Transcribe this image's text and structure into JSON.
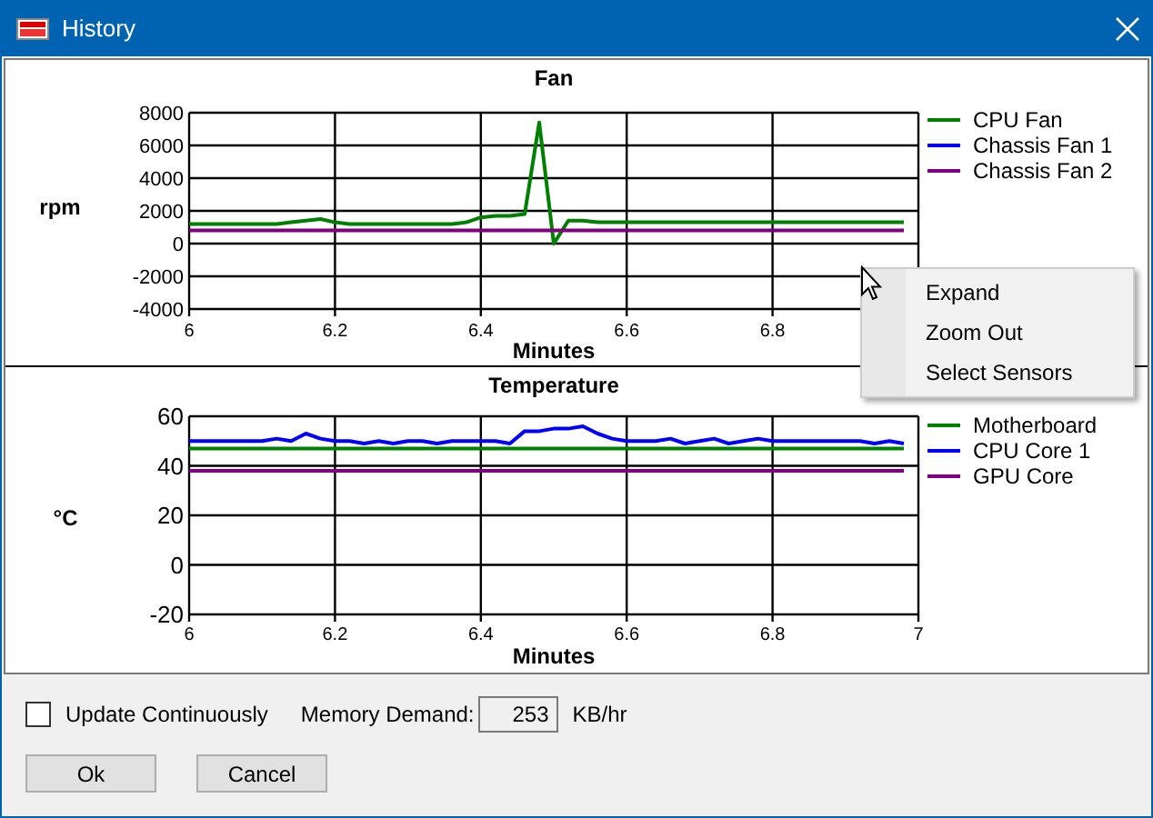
{
  "window": {
    "title": "History"
  },
  "charts": [
    {
      "kind": "fan",
      "chart_data": {
        "type": "line",
        "title": "Fan",
        "xlabel": "Minutes",
        "ylabel": "rpm",
        "grid": true,
        "legend": "right",
        "xlim": [
          6,
          7
        ],
        "ylim": [
          -4000,
          8000
        ],
        "xticks": [
          6,
          6.2,
          6.4,
          6.6,
          6.8
        ],
        "yticks": [
          -4000,
          -2000,
          0,
          2000,
          4000,
          6000,
          8000
        ],
        "x": [
          6,
          6.02,
          6.04,
          6.06,
          6.08,
          6.1,
          6.12,
          6.14,
          6.16,
          6.18,
          6.2,
          6.22,
          6.24,
          6.26,
          6.28,
          6.3,
          6.32,
          6.34,
          6.36,
          6.38,
          6.4,
          6.42,
          6.44,
          6.46,
          6.48,
          6.5,
          6.52,
          6.54,
          6.56,
          6.58,
          6.6,
          6.62,
          6.64,
          6.66,
          6.68,
          6.7,
          6.72,
          6.74,
          6.76,
          6.78,
          6.8,
          6.82,
          6.84,
          6.86,
          6.88,
          6.9,
          6.92,
          6.94,
          6.96,
          6.98
        ],
        "series": [
          {
            "name": "CPU Fan",
            "color": "#008000",
            "values": [
              1200,
              1200,
              1200,
              1200,
              1200,
              1200,
              1200,
              1300,
              1400,
              1500,
              1300,
              1200,
              1200,
              1200,
              1200,
              1200,
              1200,
              1200,
              1200,
              1300,
              1600,
              1700,
              1700,
              1800,
              7400,
              0,
              1400,
              1400,
              1300,
              1300,
              1300,
              1300,
              1300,
              1300,
              1300,
              1300,
              1300,
              1300,
              1300,
              1300,
              1300,
              1300,
              1300,
              1300,
              1300,
              1300,
              1300,
              1300,
              1300,
              1300
            ]
          },
          {
            "name": "Chassis Fan 1",
            "color": "#0000ff",
            "values": [
              null,
              null,
              null,
              null,
              null,
              null,
              null,
              null,
              null,
              null,
              null,
              null,
              null,
              null,
              null,
              null,
              null,
              null,
              null,
              null,
              null,
              null,
              null,
              null,
              null,
              null,
              null,
              null,
              null,
              null,
              null,
              null,
              null,
              null,
              null,
              null,
              null,
              null,
              null,
              null,
              null,
              null,
              null,
              null,
              null,
              null,
              null,
              null,
              null,
              null
            ]
          },
          {
            "name": "Chassis Fan 2",
            "color": "#800080",
            "values": [
              800,
              800,
              800,
              800,
              800,
              800,
              800,
              800,
              800,
              800,
              800,
              800,
              800,
              800,
              800,
              800,
              800,
              800,
              800,
              800,
              800,
              800,
              800,
              800,
              800,
              800,
              800,
              800,
              800,
              800,
              800,
              800,
              800,
              800,
              800,
              800,
              800,
              800,
              800,
              800,
              800,
              800,
              800,
              800,
              800,
              800,
              800,
              800,
              800,
              800
            ]
          }
        ]
      }
    },
    {
      "kind": "temperature",
      "chart_data": {
        "type": "line",
        "title": "Temperature",
        "xlabel": "Minutes",
        "ylabel": "°C",
        "grid": true,
        "legend": "right",
        "xlim": [
          6,
          7
        ],
        "ylim": [
          -20,
          60
        ],
        "xticks": [
          6,
          6.2,
          6.4,
          6.6,
          6.8,
          7
        ],
        "yticks": [
          -20,
          0,
          20,
          40,
          60
        ],
        "x": [
          6,
          6.02,
          6.04,
          6.06,
          6.08,
          6.1,
          6.12,
          6.14,
          6.16,
          6.18,
          6.2,
          6.22,
          6.24,
          6.26,
          6.28,
          6.3,
          6.32,
          6.34,
          6.36,
          6.38,
          6.4,
          6.42,
          6.44,
          6.46,
          6.48,
          6.5,
          6.52,
          6.54,
          6.56,
          6.58,
          6.6,
          6.62,
          6.64,
          6.66,
          6.68,
          6.7,
          6.72,
          6.74,
          6.76,
          6.78,
          6.8,
          6.82,
          6.84,
          6.86,
          6.88,
          6.9,
          6.92,
          6.94,
          6.96,
          6.98
        ],
        "series": [
          {
            "name": "Motherboard",
            "color": "#008000",
            "values": [
              47,
              47,
              47,
              47,
              47,
              47,
              47,
              47,
              47,
              47,
              47,
              47,
              47,
              47,
              47,
              47,
              47,
              47,
              47,
              47,
              47,
              47,
              47,
              47,
              47,
              47,
              47,
              47,
              47,
              47,
              47,
              47,
              47,
              47,
              47,
              47,
              47,
              47,
              47,
              47,
              47,
              47,
              47,
              47,
              47,
              47,
              47,
              47,
              47,
              47
            ]
          },
          {
            "name": "CPU Core 1",
            "color": "#0000ff",
            "values": [
              50,
              50,
              50,
              50,
              50,
              50,
              51,
              50,
              53,
              51,
              50,
              50,
              49,
              50,
              49,
              50,
              50,
              49,
              50,
              50,
              50,
              50,
              49,
              54,
              54,
              55,
              55,
              56,
              53,
              51,
              50,
              50,
              50,
              51,
              49,
              50,
              51,
              49,
              50,
              51,
              50,
              50,
              50,
              50,
              50,
              50,
              50,
              49,
              50,
              49
            ]
          },
          {
            "name": "GPU Core",
            "color": "#800080",
            "values": [
              38,
              38,
              38,
              38,
              38,
              38,
              38,
              38,
              38,
              38,
              38,
              38,
              38,
              38,
              38,
              38,
              38,
              38,
              38,
              38,
              38,
              38,
              38,
              38,
              38,
              38,
              38,
              38,
              38,
              38,
              38,
              38,
              38,
              38,
              38,
              38,
              38,
              38,
              38,
              38,
              38,
              38,
              38,
              38,
              38,
              38,
              38,
              38,
              38,
              38
            ]
          }
        ]
      }
    }
  ],
  "context_menu": {
    "items": [
      {
        "label": "Expand"
      },
      {
        "label": "Zoom Out"
      },
      {
        "label": "Select Sensors"
      }
    ]
  },
  "options": {
    "update_continuously": {
      "label": "Update Continuously",
      "checked": false
    },
    "memory_demand": {
      "label": "Memory Demand:",
      "value": "253",
      "unit": "KB/hr"
    }
  },
  "buttons": [
    {
      "label": "Ok"
    },
    {
      "label": "Cancel"
    }
  ]
}
